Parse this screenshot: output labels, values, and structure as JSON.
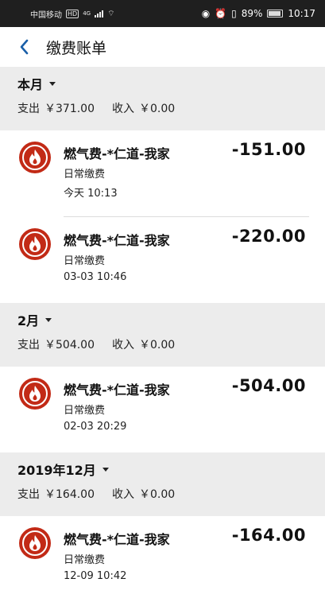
{
  "status_bar": {
    "carrier": "中国移动",
    "hd": "HD",
    "network": "4G",
    "battery_percent": "89%",
    "time": "10:17"
  },
  "header": {
    "back_icon": "chevron-left-icon",
    "title": "缴费账单"
  },
  "colors": {
    "accent": "#1a5fa8",
    "icon_red": "#c22a16",
    "section_bg": "#ececec"
  },
  "sections": [
    {
      "month": "本月",
      "expense_label": "支出",
      "expense": "￥371.00",
      "income_label": "收入",
      "income": "￥0.00",
      "items": [
        {
          "name": "燃气费-*仁道-我家",
          "category": "日常缴费",
          "time": "今天  10:13",
          "amount": "-151.00",
          "icon": "gas-flame-icon"
        },
        {
          "name": "燃气费-*仁道-我家",
          "category": "日常缴费",
          "time": "03-03  10:46",
          "amount": "-220.00",
          "icon": "gas-flame-icon"
        }
      ]
    },
    {
      "month": "2月",
      "expense_label": "支出",
      "expense": "￥504.00",
      "income_label": "收入",
      "income": "￥0.00",
      "items": [
        {
          "name": "燃气费-*仁道-我家",
          "category": "日常缴费",
          "time": "02-03  20:29",
          "amount": "-504.00",
          "icon": "gas-flame-icon"
        }
      ]
    },
    {
      "month": "2019年12月",
      "expense_label": "支出",
      "expense": "￥164.00",
      "income_label": "收入",
      "income": "￥0.00",
      "items": [
        {
          "name": "燃气费-*仁道-我家",
          "category": "日常缴费",
          "time": "12-09  10:42",
          "amount": "-164.00",
          "icon": "gas-flame-icon"
        }
      ]
    }
  ]
}
